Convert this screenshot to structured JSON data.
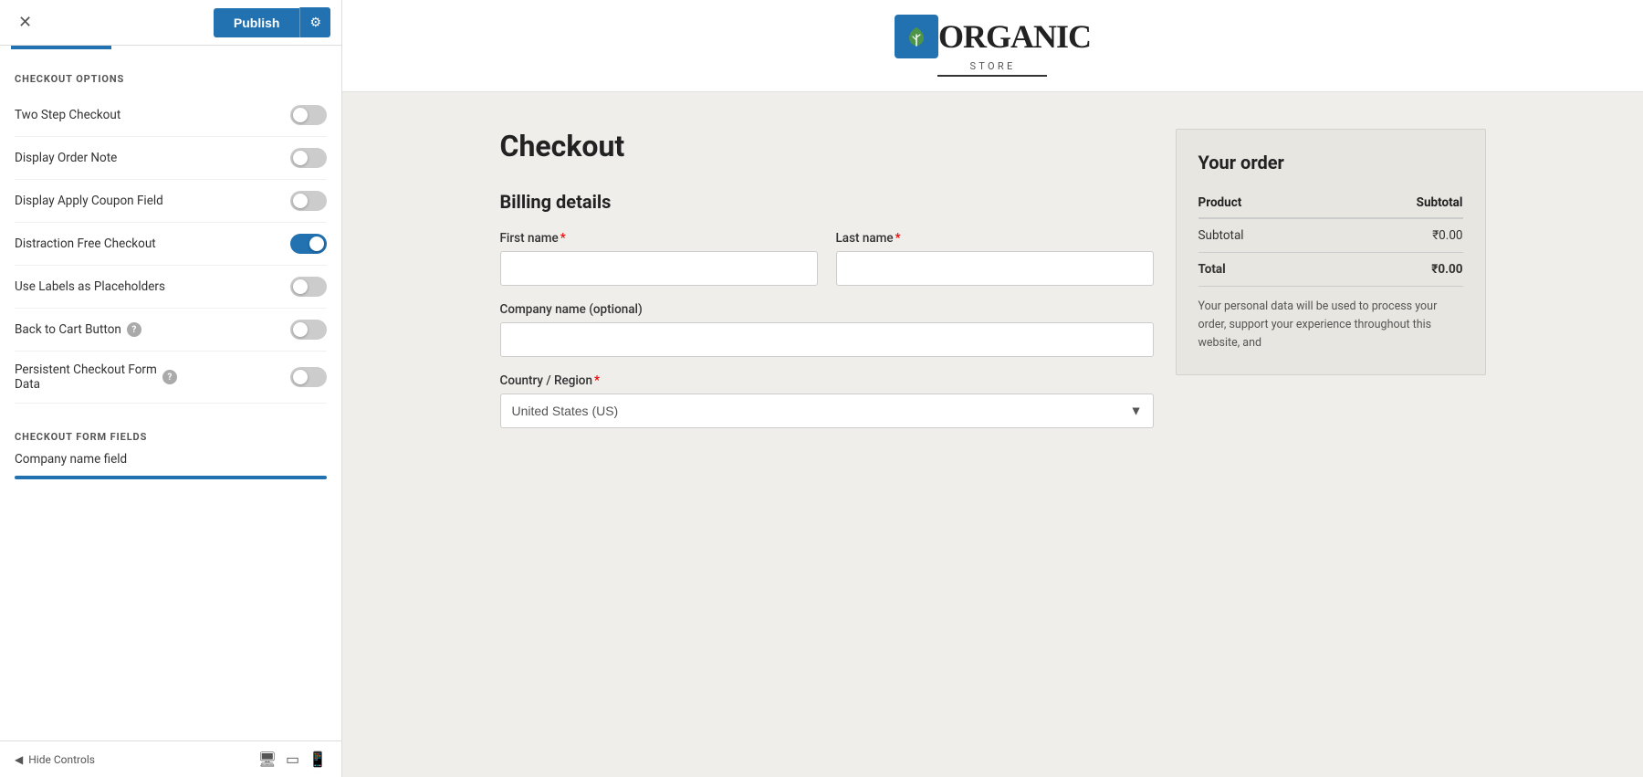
{
  "topbar": {
    "close_label": "✕",
    "publish_label": "Publish",
    "settings_icon": "⚙"
  },
  "sidebar": {
    "section1_heading": "CHECKOUT OPTIONS",
    "options": [
      {
        "id": "two-step-checkout",
        "label": "Two Step Checkout",
        "checked": false,
        "has_help": false
      },
      {
        "id": "display-order-note",
        "label": "Display Order Note",
        "checked": false,
        "has_help": false
      },
      {
        "id": "display-apply-coupon",
        "label": "Display Apply Coupon Field",
        "checked": false,
        "has_help": false
      },
      {
        "id": "distraction-free",
        "label": "Distraction Free Checkout",
        "checked": true,
        "has_help": false
      },
      {
        "id": "use-labels",
        "label": "Use Labels as Placeholders",
        "checked": false,
        "has_help": false
      },
      {
        "id": "back-to-cart",
        "label": "Back to Cart Button",
        "checked": false,
        "has_help": true
      },
      {
        "id": "persistent-checkout",
        "label": "Persistent Checkout Form Data",
        "checked": false,
        "has_help": true
      }
    ],
    "section2_heading": "CHECKOUT FORM FIELDS",
    "field_label": "Company name field",
    "bottom_bar": {
      "hide_controls_label": "Hide Controls"
    }
  },
  "header": {
    "logo_text": "ORGANIC",
    "logo_sub": "STORE"
  },
  "main": {
    "checkout_title": "Checkout",
    "billing_title": "Billing details",
    "fields": {
      "first_name_label": "First name",
      "last_name_label": "Last name",
      "company_label": "Company name (optional)",
      "country_label": "Country / Region",
      "country_value": "United States (US)"
    },
    "order_summary": {
      "title": "Your order",
      "col_product": "Product",
      "col_subtotal": "Subtotal",
      "subtotal_label": "Subtotal",
      "subtotal_value": "₹0.00",
      "total_label": "Total",
      "total_value": "₹0.00",
      "privacy_text": "Your personal data will be used to process your order, support your experience throughout this website, and"
    }
  }
}
